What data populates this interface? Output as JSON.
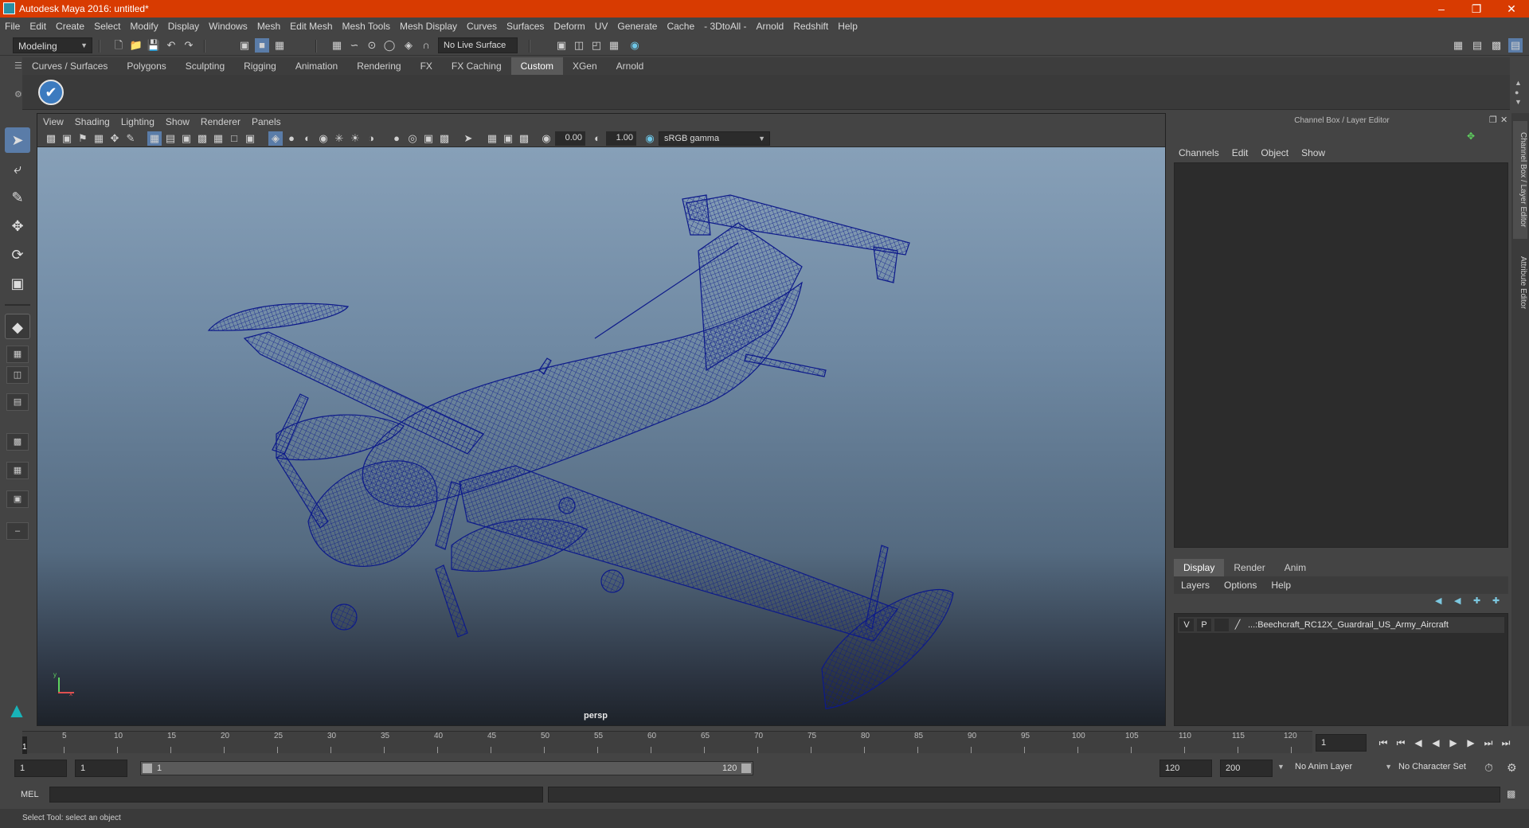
{
  "window": {
    "title": "Autodesk Maya 2016: untitled*"
  },
  "menubar": [
    "File",
    "Edit",
    "Create",
    "Select",
    "Modify",
    "Display",
    "Windows",
    "Mesh",
    "Edit Mesh",
    "Mesh Tools",
    "Mesh Display",
    "Curves",
    "Surfaces",
    "Deform",
    "UV",
    "Generate",
    "Cache",
    "- 3DtoAll -",
    "Arnold",
    "Redshift",
    "Help"
  ],
  "statusline": {
    "mode": "Modeling",
    "live_surface": "No Live Surface"
  },
  "shelf": {
    "tabs": [
      "Curves / Surfaces",
      "Polygons",
      "Sculpting",
      "Rigging",
      "Animation",
      "Rendering",
      "FX",
      "FX Caching",
      "Custom",
      "XGen",
      "Arnold"
    ],
    "active_tab": "Custom"
  },
  "viewport": {
    "menu": [
      "View",
      "Shading",
      "Lighting",
      "Show",
      "Renderer",
      "Panels"
    ],
    "exposure": "0.00",
    "gamma": "1.00",
    "color_space": "sRGB gamma",
    "camera_label": "persp",
    "axis": {
      "x": "x",
      "y": "y"
    }
  },
  "channelbox": {
    "title": "Channel Box / Layer Editor",
    "menu": [
      "Channels",
      "Edit",
      "Object",
      "Show"
    ]
  },
  "layer_editor": {
    "tabs": [
      "Display",
      "Render",
      "Anim"
    ],
    "active_tab": "Display",
    "menu": [
      "Layers",
      "Options",
      "Help"
    ],
    "layers": [
      {
        "v": "V",
        "p": "P",
        "name": "...:Beechcraft_RC12X_Guardrail_US_Army_Aircraft"
      }
    ]
  },
  "side_tabs": [
    "Channel Box / Layer Editor",
    "Attribute Editor"
  ],
  "timeslider": {
    "ticks": [
      "5",
      "10",
      "15",
      "20",
      "25",
      "30",
      "35",
      "40",
      "45",
      "50",
      "55",
      "60",
      "65",
      "70",
      "75",
      "80",
      "85",
      "90",
      "95",
      "100",
      "105",
      "110",
      "115",
      "120"
    ],
    "current": "1",
    "current_frame_field": "1"
  },
  "rangebar": {
    "start": "1",
    "start2": "1",
    "range_start": "1",
    "range_end": "120",
    "end": "120",
    "end2": "200",
    "anim_layer": "No Anim Layer",
    "character_set": "No Character Set"
  },
  "cmdline": {
    "label": "MEL"
  },
  "helpline": {
    "text": "Select Tool: select an object"
  },
  "colors": {
    "titlebar": "#d83b01",
    "wireframe": "#0d1a8a",
    "active_tool": "#5a7ca8"
  }
}
